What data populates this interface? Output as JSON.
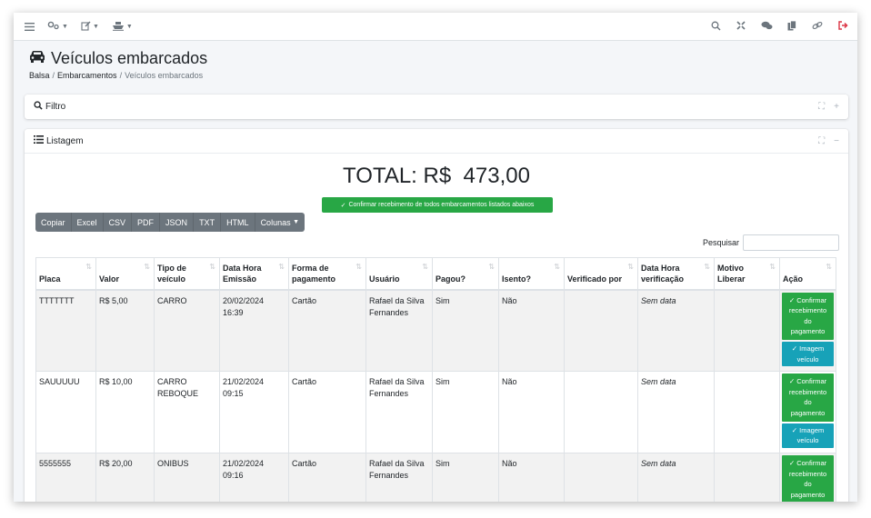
{
  "page": {
    "title": "Veículos embarcados",
    "breadcrumb": [
      "Balsa",
      "Embarcamentos",
      "Veículos embarcados"
    ]
  },
  "icons": {
    "nav_left": [
      "menu-icon",
      "cogs-icon",
      "edit-icon",
      "ship-icon"
    ],
    "nav_right": [
      "search-icon",
      "expand-icon",
      "comments-icon",
      "copy-icon",
      "link-icon",
      "logout-icon"
    ],
    "title": "car-icon"
  },
  "filter": {
    "title": "Filtro"
  },
  "listing": {
    "title": "Listagem",
    "total": "TOTAL: R$  473,00",
    "confirm_all": "Confirmar recebimento de todos embarcamentos listados abaixos",
    "toolbar": [
      "Copiar",
      "Excel",
      "CSV",
      "PDF",
      "JSON",
      "TXT",
      "HTML",
      "Colunas"
    ],
    "search_label": "Pesquisar",
    "search_value": "",
    "columns": {
      "placa": "Placa",
      "valor": "Valor",
      "tipo_l1": "Tipo de",
      "tipo_l2": "veículo",
      "dh_l1": "Data Hora",
      "dh_l2": "Emissão",
      "fp_l1": "Forma de",
      "fp_l2": "pagamento",
      "usuario": "Usuário",
      "pagou": "Pagou?",
      "isento": "Isento?",
      "verificado": "Verificado por",
      "dv_l1": "Data Hora",
      "dv_l2": "verificação",
      "motivo_l1": "Motivo",
      "motivo_l2": "Liberar",
      "acao": "Ação"
    },
    "rows": [
      {
        "placa": "TTTTTTT",
        "valor": "R$ 5,00",
        "tipo_l1": "CARRO",
        "tipo_l2": "",
        "data_l1": "20/02/2024",
        "data_l2": "16:39",
        "forma": "Cartão",
        "usuario_l1": "Rafael da Silva",
        "usuario_l2": "Fernandes",
        "pagou": "Sim",
        "isento": "Não",
        "verificado": "",
        "data_verif": "Sem data",
        "motivo": ""
      },
      {
        "placa": "SAUUUUU",
        "valor": "R$ 10,00",
        "tipo_l1": "CARRO",
        "tipo_l2": "REBOQUE",
        "data_l1": "21/02/2024",
        "data_l2": "09:15",
        "forma": "Cartão",
        "usuario_l1": "Rafael da Silva",
        "usuario_l2": "Fernandes",
        "pagou": "Sim",
        "isento": "Não",
        "verificado": "",
        "data_verif": "Sem data",
        "motivo": ""
      },
      {
        "placa": "5555555",
        "valor": "R$ 20,00",
        "tipo_l1": "ONIBUS",
        "tipo_l2": "",
        "data_l1": "21/02/2024",
        "data_l2": "09:16",
        "forma": "Cartão",
        "usuario_l1": "Rafael da Silva",
        "usuario_l2": "Fernandes",
        "pagou": "Sim",
        "isento": "Não",
        "verificado": "",
        "data_verif": "Sem data",
        "motivo": ""
      }
    ],
    "action": {
      "confirm": [
        "Confirmar",
        "recebimento",
        "do",
        "pagamento"
      ],
      "image": [
        "Imagem",
        "veículo"
      ]
    }
  }
}
